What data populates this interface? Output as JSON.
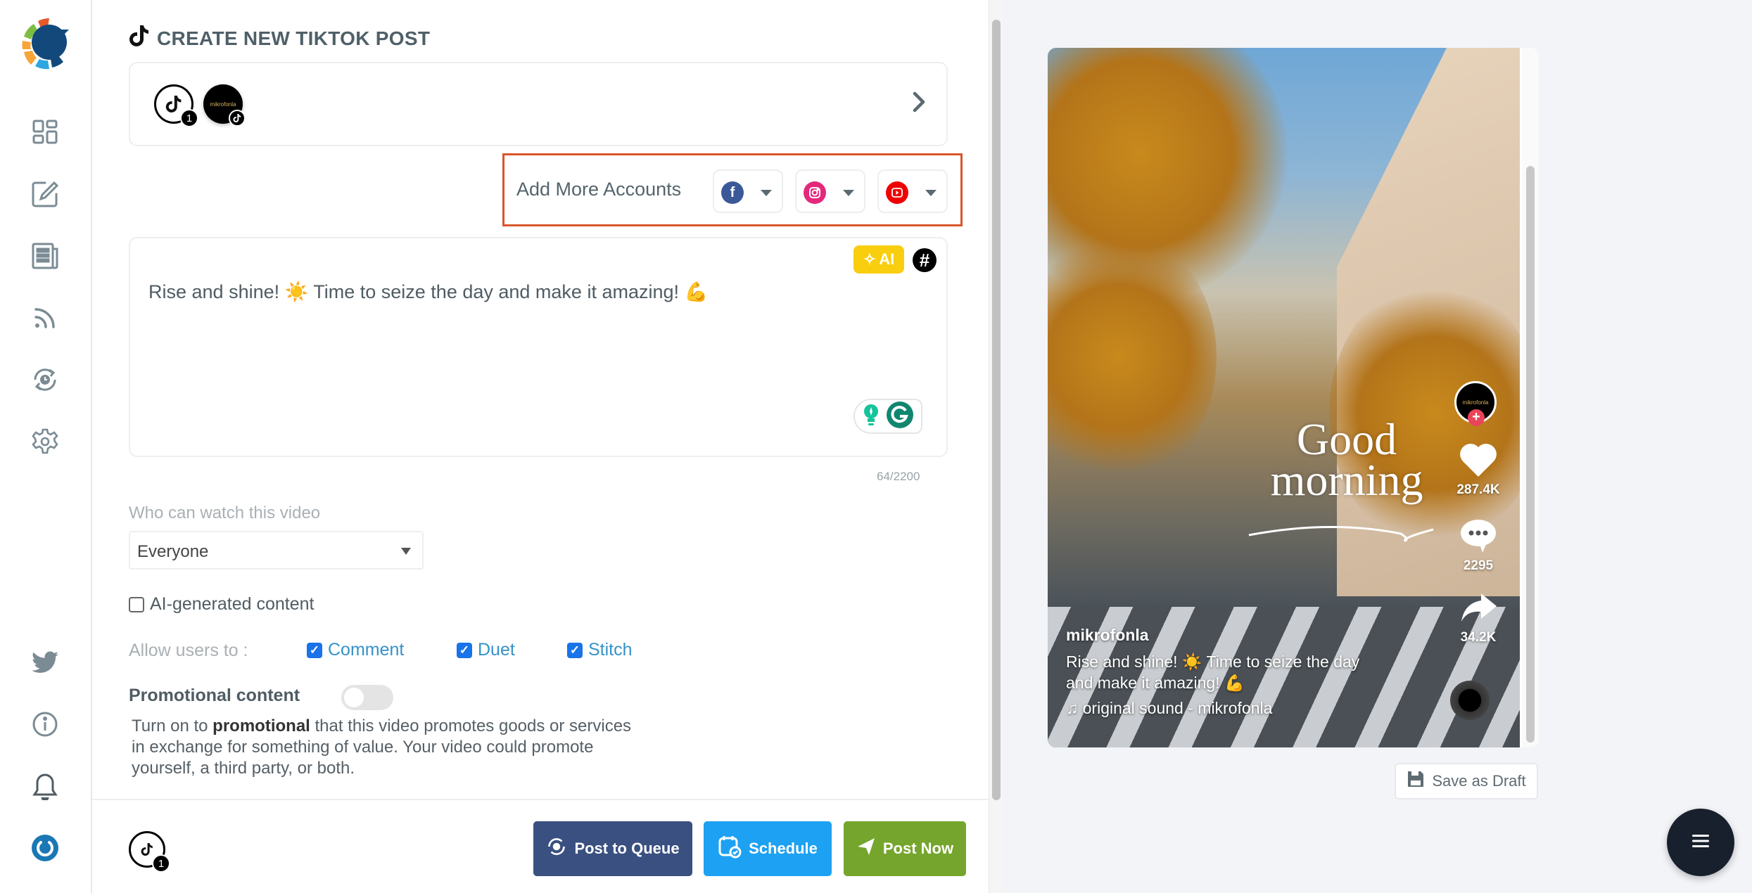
{
  "app": {
    "title": "CREATE NEW TIKTOK POST"
  },
  "sidebar": {
    "top_items": [
      {
        "name": "dashboard",
        "icon": "dashboard-grid-icon"
      },
      {
        "name": "compose",
        "icon": "edit-icon"
      },
      {
        "name": "posts",
        "icon": "newspaper-icon"
      },
      {
        "name": "rss",
        "icon": "rss-icon"
      },
      {
        "name": "queue",
        "icon": "recycle-clock-icon"
      },
      {
        "name": "settings",
        "icon": "gear-icon"
      }
    ],
    "bottom_items": [
      {
        "name": "twitter",
        "icon": "twitter-icon"
      },
      {
        "name": "info",
        "icon": "info-icon"
      },
      {
        "name": "notifications",
        "icon": "bell-icon"
      },
      {
        "name": "logout",
        "icon": "power-icon"
      }
    ]
  },
  "accounts": {
    "selected": [
      {
        "type": "tiktok-group",
        "badge": "1"
      },
      {
        "name": "mikrofonla",
        "network": "tiktok"
      }
    ]
  },
  "add_more": {
    "label": "Add More Accounts",
    "networks": [
      {
        "name": "facebook",
        "color": "#3b5998"
      },
      {
        "name": "instagram",
        "color": "#e4287b"
      },
      {
        "name": "youtube",
        "color": "#f00000"
      }
    ]
  },
  "editor": {
    "text": "Rise and shine! ☀️ Time to seize the day and make it amazing! 💪",
    "ai_label": "AI",
    "counter": "64/2200"
  },
  "privacy": {
    "label": "Who can watch this video",
    "selected": "Everyone"
  },
  "ai_generated": {
    "label": "AI-generated content",
    "checked": false
  },
  "allow": {
    "label": "Allow users to :",
    "options": [
      {
        "label": "Comment",
        "checked": true
      },
      {
        "label": "Duet",
        "checked": true
      },
      {
        "label": "Stitch",
        "checked": true
      }
    ]
  },
  "promotional": {
    "label": "Promotional content",
    "enabled": false,
    "desc_pre": "Turn on to ",
    "desc_bold": "promotional",
    "desc_post": " that this video promotes goods or services in exchange for something of value. Your video could promote yourself, a third party, or both."
  },
  "footer": {
    "account_badge": "1",
    "buttons": {
      "queue": "Post to Queue",
      "schedule": "Schedule",
      "post_now": "Post Now"
    },
    "colors": {
      "queue": "#3a5080",
      "schedule": "#1da1f2",
      "post_now": "#75a52c"
    }
  },
  "preview": {
    "overlay_line1": "Good",
    "overlay_line2": "morning",
    "avatar_text": "mikrofonla",
    "likes": "287.4K",
    "comments": "2295",
    "shares": "34.2K",
    "username": "mikrofonla",
    "caption": "Rise and shine! ☀️ Time to seize the day and make it amazing! 💪",
    "sound": "original sound - mikrofonla",
    "save_draft": "Save as Draft"
  }
}
